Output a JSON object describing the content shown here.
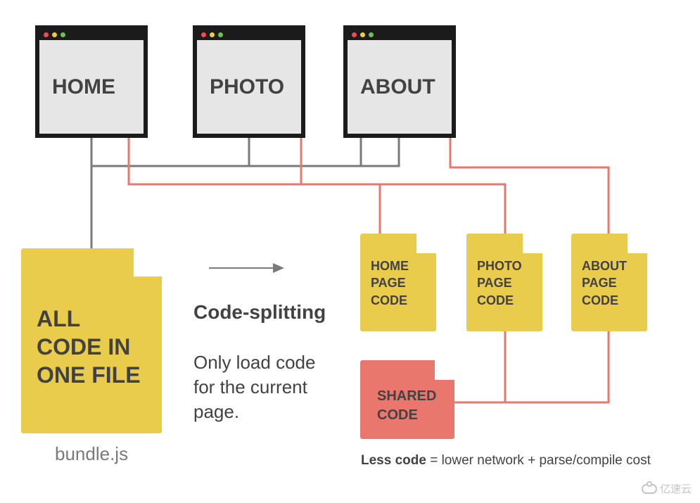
{
  "windows": {
    "home": {
      "label": "HOME"
    },
    "photo": {
      "label": "PHOTO"
    },
    "about": {
      "label": "ABOUT"
    }
  },
  "bundle": {
    "title": "ALL CODE IN ONE FILE",
    "filename": "bundle.js"
  },
  "chunks": {
    "home": "HOME PAGE CODE",
    "photo": "PHOTO PAGE CODE",
    "about": "ABOUT PAGE CODE",
    "shared": "SHARED CODE"
  },
  "annotation": {
    "title": "Code-splitting",
    "body": "Only load code for the current page."
  },
  "footer": {
    "bold": "Less code",
    "rest": " = lower network + parse/compile cost"
  },
  "watermark": "亿速云"
}
